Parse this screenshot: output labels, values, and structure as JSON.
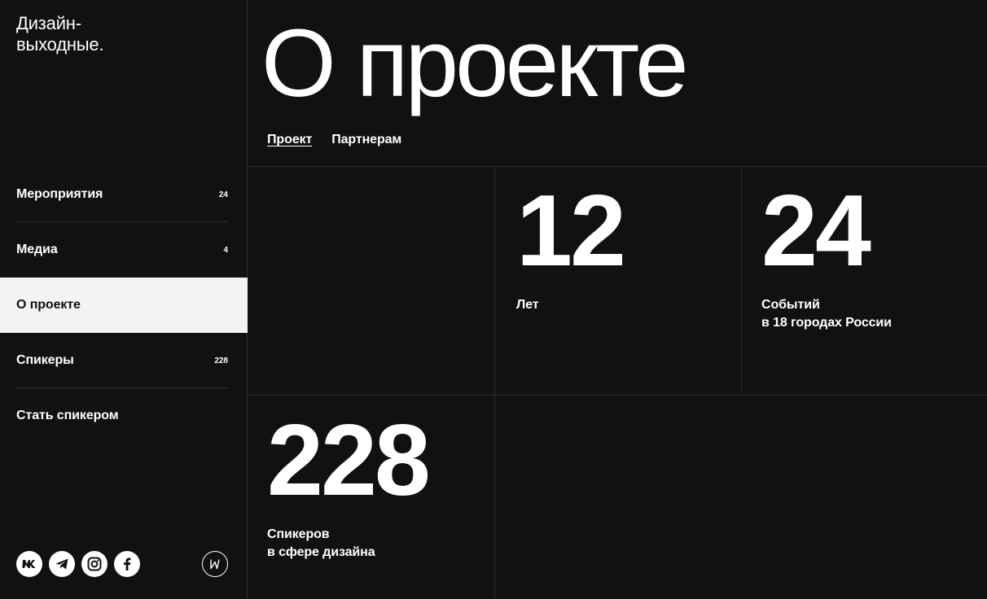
{
  "sidebar": {
    "logo_line1": "Дизайн-",
    "logo_line2": "выходные.",
    "nav": [
      {
        "label": "Мероприятия",
        "count": "24"
      },
      {
        "label": "Медиа",
        "count": "4"
      },
      {
        "label": "О проекте",
        "count": ""
      },
      {
        "label": "Спикеры",
        "count": "228"
      },
      {
        "label": "Стать спикером",
        "count": ""
      }
    ],
    "social": [
      "vk-icon",
      "telegram-icon",
      "instagram-icon",
      "facebook-icon"
    ],
    "brand_icon": "w-logo-icon"
  },
  "main": {
    "title": "О проекте",
    "tabs": [
      {
        "label": "Проект",
        "active": true
      },
      {
        "label": "Партнерам",
        "active": false
      }
    ],
    "stats": [
      {
        "value": "12",
        "label_line1": "Лет",
        "label_line2": ""
      },
      {
        "value": "24",
        "label_line1": "Событий",
        "label_line2": "в 18 городах России"
      },
      {
        "value": "228",
        "label_line1": "Спикеров",
        "label_line2": "в сфере дизайна"
      }
    ]
  },
  "colors": {
    "background": "#111111",
    "text": "#ffffff",
    "active_nav_bg": "#f4f4f4",
    "divider": "#2c2c2c"
  }
}
